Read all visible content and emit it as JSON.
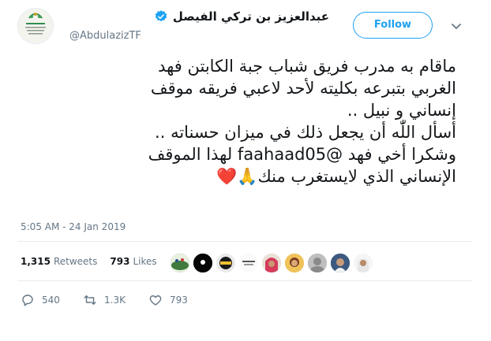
{
  "user": {
    "name": "عبدالعزيز بن تركي الفيصل",
    "handle": "@AbdulazizTF"
  },
  "follow_label": "Follow",
  "tweet_lines": [
    "ماقام به مدرب فريق شباب جبة الكابتن فهد",
    "الغربي بتبرعه بكليته لأحد لاعبي فريقه موقف",
    "إنساني و نبيل ..",
    "أسأل اللّٰه أن يجعل ذلك في ميزان حسناته ..",
    "وشكرا أخي فهد @faahaad05 لهذا الموقف",
    "الإنساني الذي لايستغرب منك"
  ],
  "tweet_emojis": "🙏❤️",
  "timestamp": "5:05 AM - 24 Jan 2019",
  "stats": {
    "retweets_count": "1,315",
    "retweets_label": "Retweets",
    "likes_count": "793",
    "likes_label": "Likes"
  },
  "actions": {
    "reply_count": "540",
    "retweet_count": "1.3K",
    "like_count": "793"
  },
  "colors": {
    "accent": "#1da1f2",
    "secondary_text": "#657786",
    "divider": "#e6ecf0",
    "heart": "#e0245e"
  },
  "icons": [
    "chevron-down-icon",
    "verified-badge-icon",
    "reply-icon",
    "retweet-icon",
    "like-icon"
  ]
}
